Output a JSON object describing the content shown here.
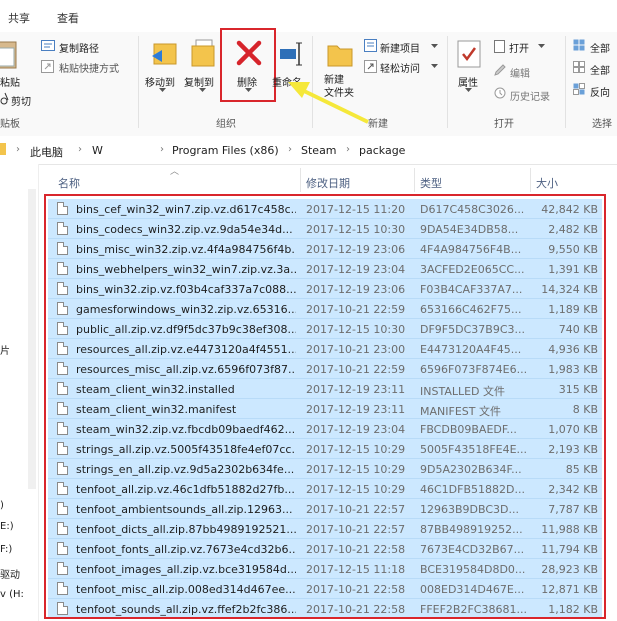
{
  "tabs": [
    "共享",
    "查看"
  ],
  "ribbon": {
    "copy_path": "复制路径",
    "paste_shortcut": "粘贴快捷方式",
    "paste": "粘贴",
    "cut": "剪切",
    "clipboard_group": "贴板",
    "move_to": "移动到",
    "copy_to": "复制到",
    "delete": "删除",
    "rename": "重命名",
    "organize_group": "组织",
    "new_folder": "新建\n文件夹",
    "new_item": "新建项目",
    "easy_access": "轻松访问",
    "new_group": "新建",
    "properties": "属性",
    "open": "打开",
    "edit": "编辑",
    "history": "历史记录",
    "open_group": "打开",
    "select_all": "全部",
    "select_none": "全部",
    "invert": "反向",
    "select_group": "选择"
  },
  "address": {
    "crumbs": [
      "此电脑",
      "W",
      "Program Files (x86)",
      "Steam",
      "package"
    ]
  },
  "nav": [
    "片",
    ")",
    "E:)",
    "F:)",
    "驱动",
    "v (H:"
  ],
  "columns": {
    "name": "名称",
    "date": "修改日期",
    "type": "类型",
    "size": "大小"
  },
  "files": [
    {
      "name": "bins_cef_win32_win7.zip.vz.d617c458c...",
      "date": "2017-12-15 11:20",
      "type": "D617C458C3026...",
      "size": "42,842 KB"
    },
    {
      "name": "bins_codecs_win32.zip.vz.9da54e34d...",
      "date": "2017-12-15 10:30",
      "type": "9DA54E34DB58...",
      "size": "2,482 KB"
    },
    {
      "name": "bins_misc_win32.zip.vz.4f4a984756f4b...",
      "date": "2017-12-19 23:06",
      "type": "4F4A984756F4B...",
      "size": "9,550 KB"
    },
    {
      "name": "bins_webhelpers_win32_win7.zip.vz.3a...",
      "date": "2017-12-19 23:04",
      "type": "3ACFED2E065CC...",
      "size": "1,391 KB"
    },
    {
      "name": "bins_win32.zip.vz.f03b4caf337a7c088...",
      "date": "2017-12-19 23:06",
      "type": "F03B4CAF337A7...",
      "size": "14,324 KB"
    },
    {
      "name": "gamesforwindows_win32.zip.vz.65316...",
      "date": "2017-10-21 22:59",
      "type": "653166C462F75...",
      "size": "1,189 KB"
    },
    {
      "name": "public_all.zip.vz.df9f5dc37b9c38ef308...",
      "date": "2017-12-15 10:30",
      "type": "DF9F5DC37B9C3...",
      "size": "740 KB"
    },
    {
      "name": "resources_all.zip.vz.e4473120a4f4551...",
      "date": "2017-10-21 23:00",
      "type": "E4473120A4F45...",
      "size": "4,936 KB"
    },
    {
      "name": "resources_misc_all.zip.vz.6596f073f87...",
      "date": "2017-10-21 22:59",
      "type": "6596F073F874E6...",
      "size": "1,983 KB"
    },
    {
      "name": "steam_client_win32.installed",
      "date": "2017-12-19 23:11",
      "type": "INSTALLED 文件",
      "size": "315 KB"
    },
    {
      "name": "steam_client_win32.manifest",
      "date": "2017-12-19 23:11",
      "type": "MANIFEST 文件",
      "size": "8 KB"
    },
    {
      "name": "steam_win32.zip.vz.fbcdb09baedf462...",
      "date": "2017-12-19 23:04",
      "type": "FBCDB09BAEDF...",
      "size": "1,070 KB"
    },
    {
      "name": "strings_all.zip.vz.5005f43518fe4ef07cc...",
      "date": "2017-12-15 10:29",
      "type": "5005F43518FE4E...",
      "size": "2,193 KB"
    },
    {
      "name": "strings_en_all.zip.vz.9d5a2302b634fe...",
      "date": "2017-12-15 10:29",
      "type": "9D5A2302B634F...",
      "size": "85 KB"
    },
    {
      "name": "tenfoot_all.zip.vz.46c1dfb51882d27fb...",
      "date": "2017-12-15 10:29",
      "type": "46C1DFB51882D...",
      "size": "2,342 KB"
    },
    {
      "name": "tenfoot_ambientsounds_all.zip.12963...",
      "date": "2017-10-21 22:57",
      "type": "12963B9DBC3D...",
      "size": "7,787 KB"
    },
    {
      "name": "tenfoot_dicts_all.zip.87bb4989192521...",
      "date": "2017-10-21 22:57",
      "type": "87BB498919252...",
      "size": "11,988 KB"
    },
    {
      "name": "tenfoot_fonts_all.zip.vz.7673e4cd32b6...",
      "date": "2017-10-21 22:58",
      "type": "7673E4CD32B67...",
      "size": "11,794 KB"
    },
    {
      "name": "tenfoot_images_all.zip.vz.bce319584d...",
      "date": "2017-12-15 11:18",
      "type": "BCE319584D8D0...",
      "size": "28,923 KB"
    },
    {
      "name": "tenfoot_misc_all.zip.008ed314d467ee...",
      "date": "2017-10-21 22:58",
      "type": "008ED314D467E...",
      "size": "12,871 KB"
    },
    {
      "name": "tenfoot_sounds_all.zip.vz.ffef2b2fc386...",
      "date": "2017-10-21 22:58",
      "type": "FFEF2B2FC38681...",
      "size": "1,182 KB"
    }
  ],
  "colors": {
    "selection": "#cce8ff",
    "highlight": "#d9262c",
    "arrow": "#f5e83a",
    "delete_x": "#d6242b"
  }
}
